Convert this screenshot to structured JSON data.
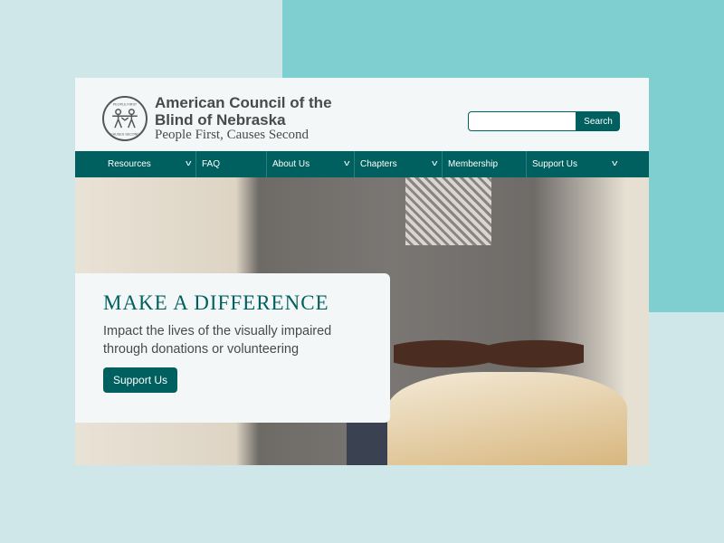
{
  "header": {
    "title": "American Council of the Blind of Nebraska",
    "tagline": "People First, Causes Second",
    "logo_text_top": "PEOPLE FIRST",
    "logo_text_bottom": "CAUSES SECOND",
    "search_placeholder": "",
    "search_button": "Search"
  },
  "nav": [
    {
      "label": "Resources",
      "dropdown": true
    },
    {
      "label": "FAQ",
      "dropdown": false
    },
    {
      "label": "About Us",
      "dropdown": true
    },
    {
      "label": "Chapters",
      "dropdown": true
    },
    {
      "label": "Membership",
      "dropdown": false
    },
    {
      "label": "Support Us",
      "dropdown": true
    }
  ],
  "hero": {
    "heading": "MAKE A DIFFERENCE",
    "text": "Impact the lives of the visually impaired through donations or volunteering",
    "button": "Support Us"
  },
  "colors": {
    "brand": "#005f5f",
    "background": "#cfe7e8",
    "accent_block": "#80cfd0"
  }
}
